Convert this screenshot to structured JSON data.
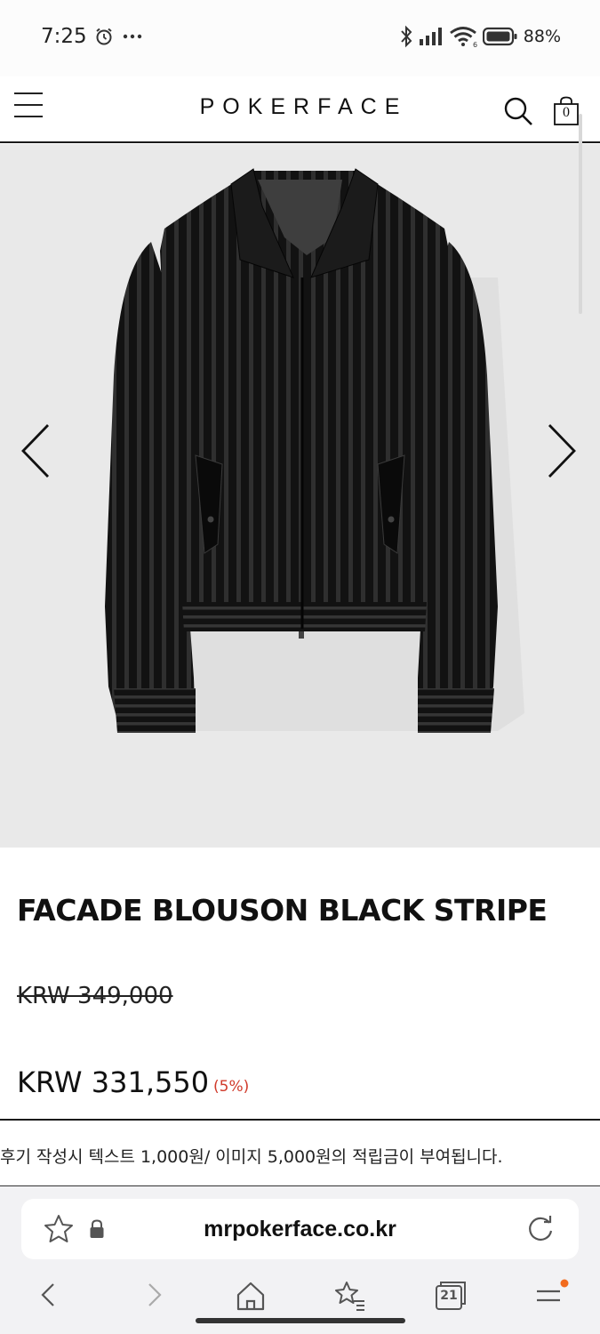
{
  "status_bar": {
    "time": "7:25",
    "battery_percent": "88%",
    "icons": [
      "alarm-icon",
      "more-dots-icon",
      "bluetooth-icon",
      "signal-icon",
      "wifi-icon",
      "battery-icon"
    ]
  },
  "header": {
    "brand": "POKERFACE",
    "cart_count": "0",
    "icons": [
      "menu-icon",
      "search-icon",
      "shopping-bag-icon"
    ]
  },
  "product": {
    "name": "FACADE BLOUSON BLACK STRIPE",
    "original_price": "KRW 349,000",
    "sale_price": "KRW 331,550",
    "discount": "(5%)",
    "image_alt": "black striped blouson jacket"
  },
  "notice": {
    "text": "후기 작성시 텍스트 1,000원/ 이미지 5,000원의 적립금이 부여됩니다."
  },
  "browser": {
    "url": "mrpokerface.co.kr",
    "tabs_count": "21",
    "icons": [
      "star-icon",
      "lock-icon",
      "reload-icon",
      "back-icon",
      "forward-icon",
      "home-icon",
      "bookmarks-icon",
      "tabs-icon",
      "menu-icon"
    ]
  },
  "colors": {
    "accent_red": "#d03a2b",
    "gallery_bg": "#e9e9e9",
    "notification_dot": "#f26b1d"
  }
}
